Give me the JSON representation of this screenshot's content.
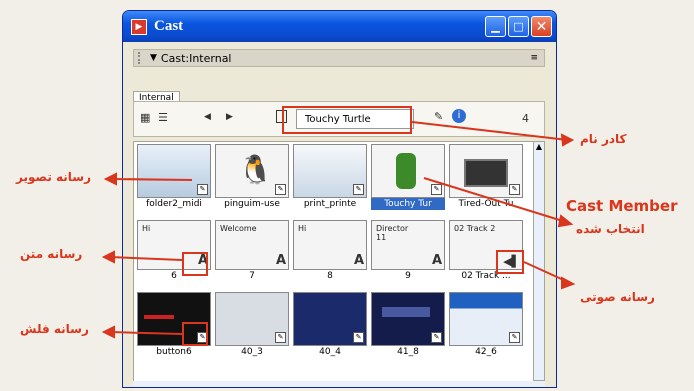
{
  "window": {
    "title": "Cast",
    "panel_title": "Cast:Internal",
    "tab": "Internal",
    "name_field": "Touchy Turtle",
    "page_num": "4"
  },
  "cast_members": [
    {
      "label": "folder2_midi",
      "selected": false,
      "kind": "bitmap"
    },
    {
      "label": "pinguim-use",
      "selected": false,
      "kind": "bitmap"
    },
    {
      "label": "print_printe",
      "selected": false,
      "kind": "bitmap"
    },
    {
      "label": "Touchy Tur",
      "selected": true,
      "kind": "bitmap"
    },
    {
      "label": "Tired-Out Tu",
      "selected": false,
      "kind": "bitmap"
    },
    {
      "label": "6",
      "text": "Hi",
      "kind": "text"
    },
    {
      "label": "7",
      "text": "Welcome",
      "kind": "text"
    },
    {
      "label": "8",
      "text": "Hi",
      "kind": "text"
    },
    {
      "label": "9",
      "text": "Director 11",
      "kind": "text"
    },
    {
      "label": "02 Track ...",
      "text": "02 Track 2",
      "kind": "sound"
    },
    {
      "label": "button6",
      "kind": "flash"
    },
    {
      "label": "40_3",
      "kind": "bitmap"
    },
    {
      "label": "40_4",
      "kind": "bitmap"
    },
    {
      "label": "41_8",
      "kind": "bitmap"
    },
    {
      "label": "42_6",
      "kind": "bitmap"
    }
  ],
  "annotations": {
    "name_box": "کادر نام",
    "cast_member": "Cast Member",
    "selected": "انتخاب شده",
    "image_media": "رسانه تصویر",
    "text_media": "رسانه متن",
    "sound_media": "رسانه صوتی",
    "flash_media": "رسانه فلش"
  },
  "colors": {
    "accent": "#d9361e",
    "title_bar": "#0b55e0",
    "selection": "#316ac5"
  }
}
